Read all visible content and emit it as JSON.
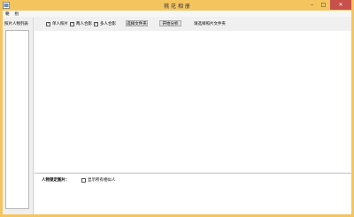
{
  "window": {
    "title": "桃 花 相 册"
  },
  "menu": {
    "items": [
      "朝",
      "别"
    ]
  },
  "left_panel": {
    "title": "照片人物列表"
  },
  "toolbar": {
    "checkboxes": [
      {
        "label": "单人照片",
        "checked": true
      },
      {
        "label": "两人合影",
        "checked": true
      },
      {
        "label": "多人合影",
        "checked": true
      }
    ],
    "select_folder_label": "选择文件夹",
    "start_analysis_label": "开始分析",
    "status_text": "请选择照片文件夹"
  },
  "bottom": {
    "label": "人物锁定图片：",
    "checkbox_label": "显示所有相似人",
    "checkbox_checked": false
  },
  "colors": {
    "titlebar": "#f4c55f",
    "close": "#c7504b"
  }
}
